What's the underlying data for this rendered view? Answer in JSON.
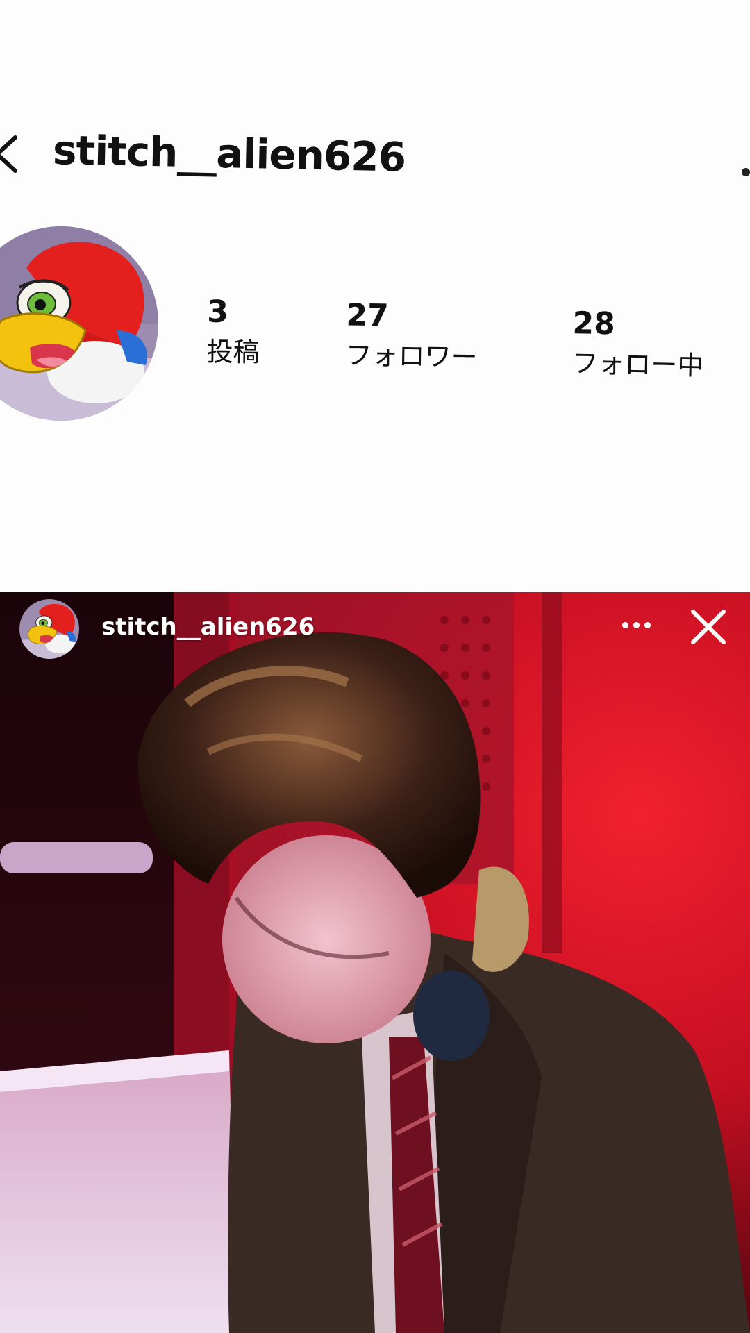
{
  "profile": {
    "username": "stitch__alien626",
    "back_icon": "chevron-left-icon",
    "menu_icon": "more-dots-icon",
    "avatar_icon": "woodpecker-cartoon-avatar",
    "stats": [
      {
        "value": "3",
        "label": "投稿"
      },
      {
        "value": "27",
        "label": "フォロワー"
      },
      {
        "value": "28",
        "label": "フォロー中"
      }
    ]
  },
  "story": {
    "username": "stitch__alien626",
    "avatar_icon": "woodpecker-cartoon-avatar",
    "more_icon": "more-horizontal-icon",
    "close_icon": "close-icon"
  },
  "colors": {
    "background": "#fdfdfd",
    "text": "#111111",
    "story_red": "#e01528",
    "story_text": "#ffffff"
  }
}
